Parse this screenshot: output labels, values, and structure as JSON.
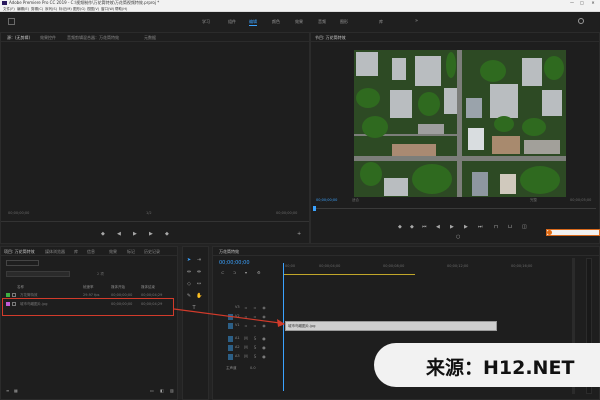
{
  "titlebar": {
    "title": "Adobe Premiere Pro CC 2019 - C:\\视频制作\\万花筒特效\\万花筒视频特效.prproj *",
    "min": "—",
    "max": "□",
    "close": "✕"
  },
  "menu": [
    "文件(F)",
    "编辑(E)",
    "剪辑(C)",
    "序列(S)",
    "标记(M)",
    "图形(G)",
    "视图(V)",
    "窗口(W)",
    "帮助(H)"
  ],
  "workspaces": {
    "tabs": [
      "学习",
      "组件",
      "编辑",
      "颜色",
      "效果",
      "音频",
      "图形",
      "库"
    ],
    "active_index": 2,
    "more": "»"
  },
  "source_panel": {
    "tabs": [
      "源：(无剪辑)",
      "效果控件",
      "音频剪辑混合器：万花筒特效",
      "元数据"
    ],
    "time_left": "00;00;00;00",
    "time_right": "00;00;00;00",
    "page": "1/2"
  },
  "program_panel": {
    "tab": "节目: 万花筒特效",
    "timecode": "00;00;00;00",
    "fit": "适合",
    "zoom": "完整",
    "duration": "00;00;05;00"
  },
  "project_panel": {
    "tabs": [
      "项目: 万花筒特效",
      "媒体浏览器",
      "库",
      "信息",
      "效果",
      "标记",
      "历史记录"
    ],
    "search_placeholder": "",
    "count": "2 项",
    "columns": [
      "名称",
      "帧速率",
      "媒体开始",
      "媒体结束"
    ],
    "rows": [
      {
        "name": "万花筒特效",
        "fps": "29.97 fps",
        "start": "00;00;00;00",
        "end": "00;00;04;29"
      },
      {
        "name": "城市鸟瞰图片.jpg",
        "fps": "",
        "start": "00;00;00;00",
        "end": "00;00;04;29"
      }
    ]
  },
  "timeline": {
    "tab": "万花筒特效",
    "timecode": "00;00;00;00",
    "ruler": [
      "00;00",
      "00;00;04;00",
      "00;00;08;00",
      "00;00;12;00",
      "00;00;16;00"
    ],
    "video_tracks": [
      "V3",
      "V2",
      "V1"
    ],
    "audio_tracks": [
      "A1",
      "A2",
      "A3"
    ],
    "master": "主声道",
    "master_value": "0.0",
    "clip_label": "城市鸟瞰图片.jpg"
  },
  "watermark": {
    "text": "来源：H12.NET"
  },
  "colors": {
    "accent": "#3ba3ff",
    "highlight": "#d23b2b",
    "panel_bg": "#1e1e1e",
    "app_bg": "#232323"
  }
}
